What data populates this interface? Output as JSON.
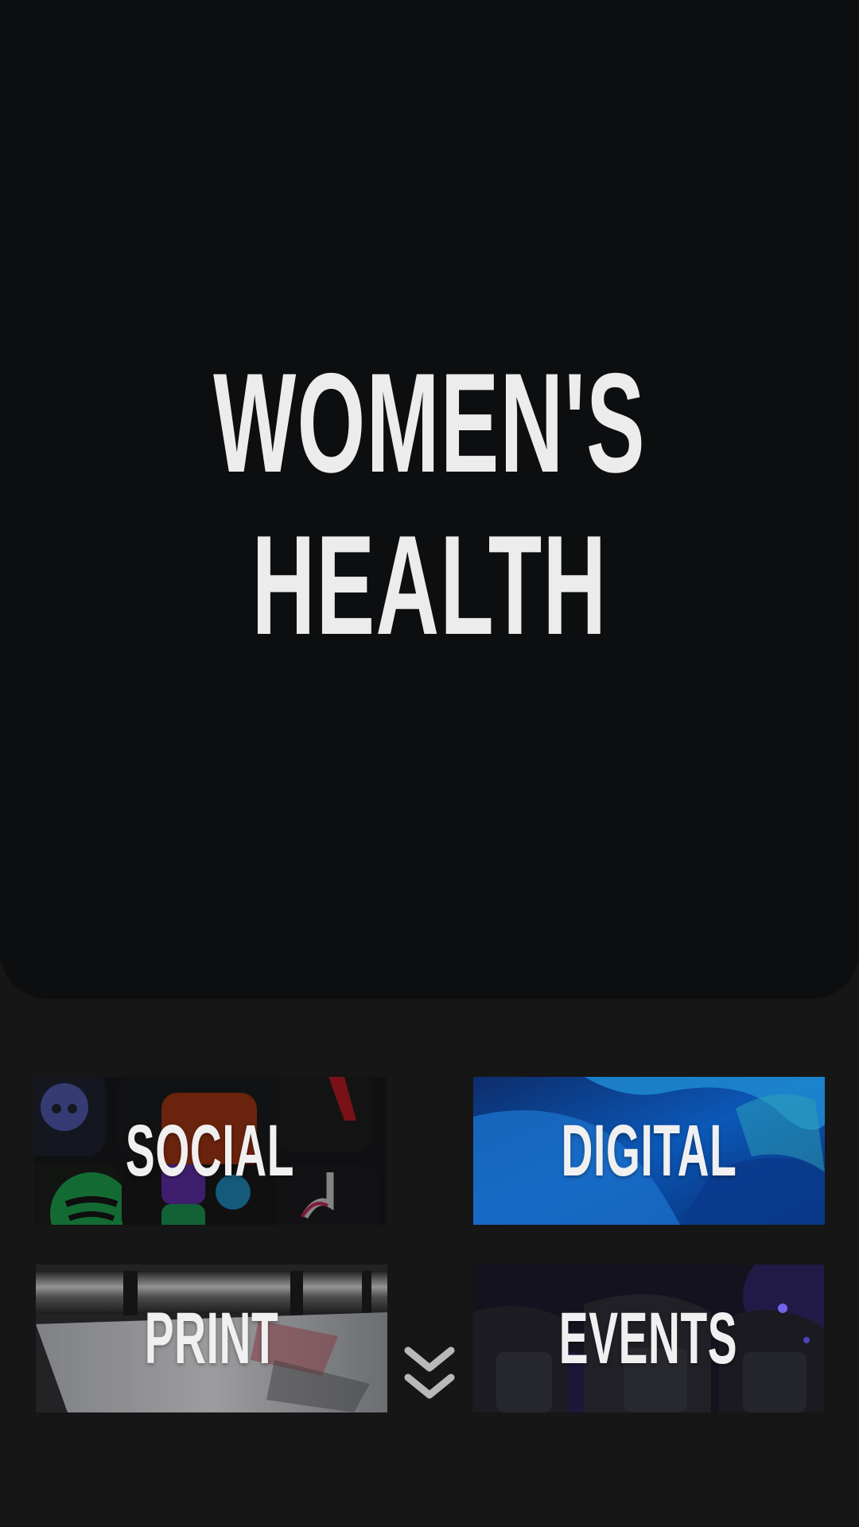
{
  "hero": {
    "title_line1": "WOMEN'S",
    "title_line2": "HEALTH"
  },
  "tiles": [
    {
      "label": "SOCIAL"
    },
    {
      "label": "DIGITAL"
    },
    {
      "label": "PRINT"
    },
    {
      "label": "EVENTS"
    }
  ],
  "scroll_indicator": {
    "icon": "double-chevron-down-icon"
  },
  "colors": {
    "page_background": "#161616",
    "hero_background": "#0d0e10",
    "title_text": "#ececec",
    "digital_blue": "#0b58b8"
  }
}
